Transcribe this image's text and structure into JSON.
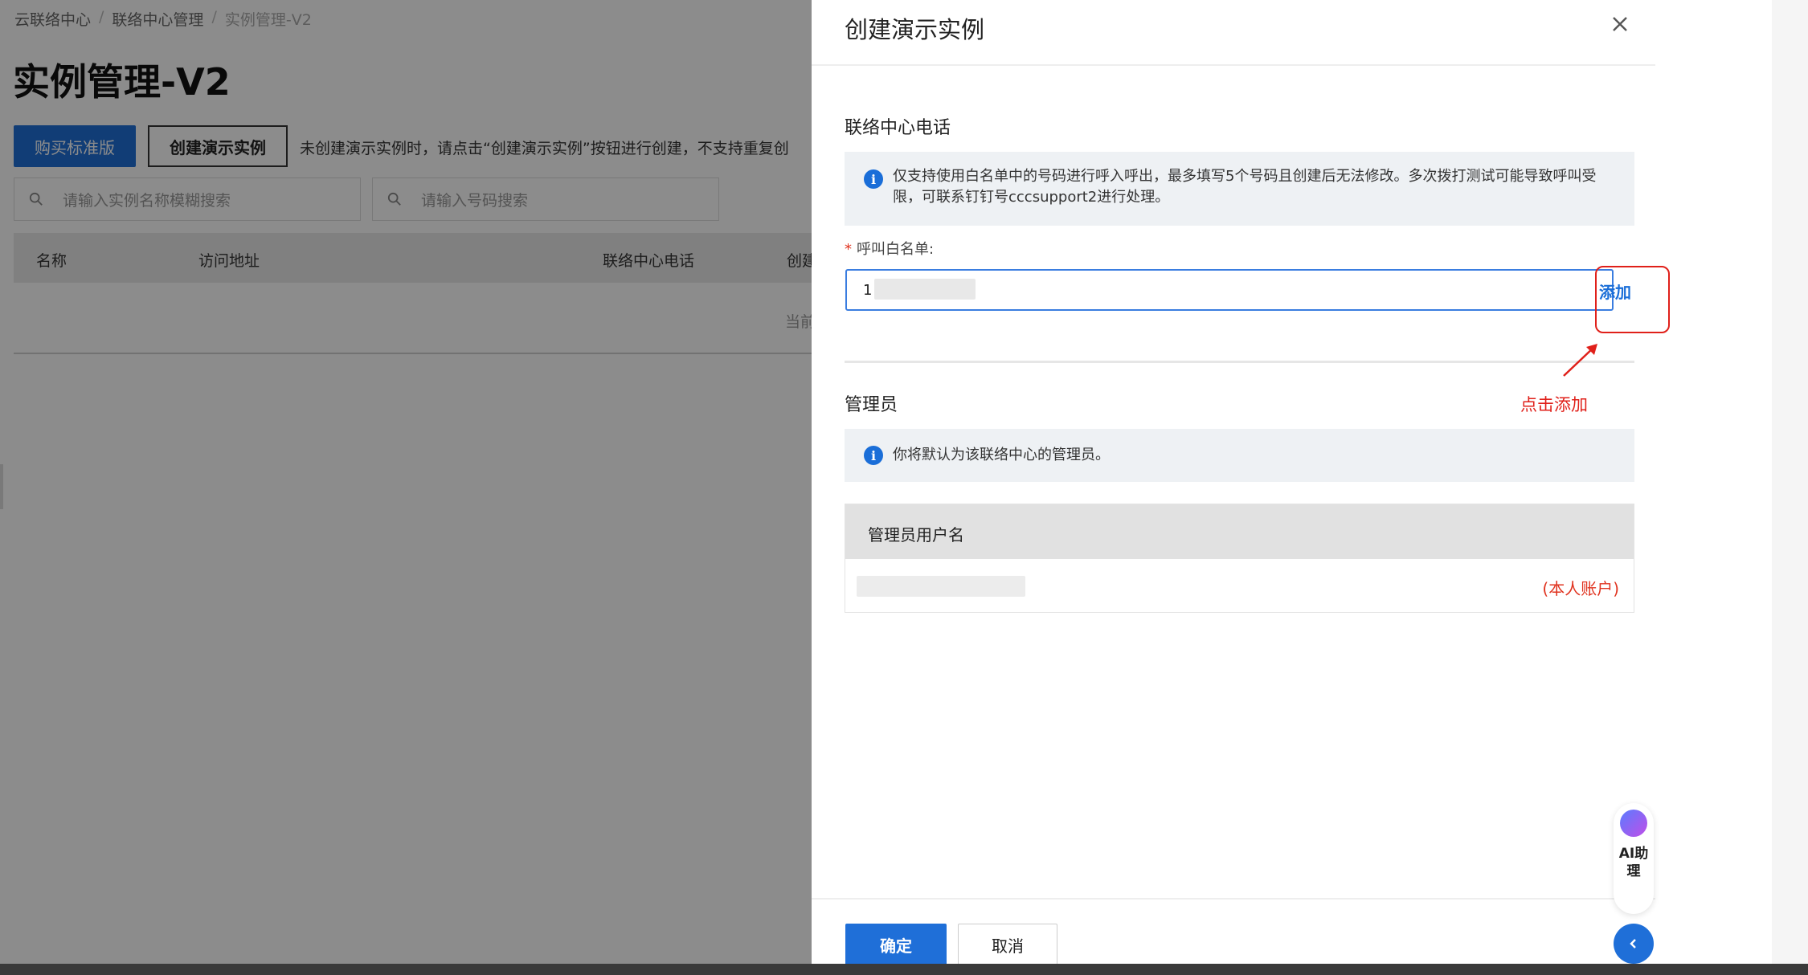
{
  "background": {
    "breadcrumb": [
      "云联络中心",
      "联络中心管理",
      "实例管理-V2"
    ],
    "page_title": "实例管理-V2",
    "buy_button": "购买标准版",
    "create_button": "创建演示实例",
    "hint": "未创建演示实例时，请点击“创建演示实例”按钮进行创建，不支持重复创",
    "search_name_placeholder": "请输入实例名称模糊搜索",
    "search_number_placeholder": "请输入号码搜索",
    "table_columns": [
      "名称",
      "访问地址",
      "联络中心电话",
      "创建"
    ],
    "empty_hint": "当前"
  },
  "drawer": {
    "title": "创建演示实例",
    "phone_section": {
      "title": "联络中心电话",
      "info": "仅支持使用白名单中的号码进行呼入呼出，最多填写5个号码且创建后无法修改。多次拨打测试可能导致呼叫受限，可联系钉钉号cccsupport2进行处理。",
      "whitelist_label": "呼叫白名单:",
      "whitelist_value": "1",
      "add_link": "添加"
    },
    "annotation": "点击添加",
    "admin_section": {
      "title": "管理员",
      "info": "你将默认为该联络中心的管理员。",
      "column": "管理员用户名",
      "self_tag": "(本人账户)"
    },
    "ok_button": "确定",
    "cancel_button": "取消"
  },
  "ai_assistant": {
    "label": "AI助理"
  },
  "colors": {
    "primary": "#1f6fd8",
    "annotation": "#e0201a",
    "required": "#e0331f"
  }
}
